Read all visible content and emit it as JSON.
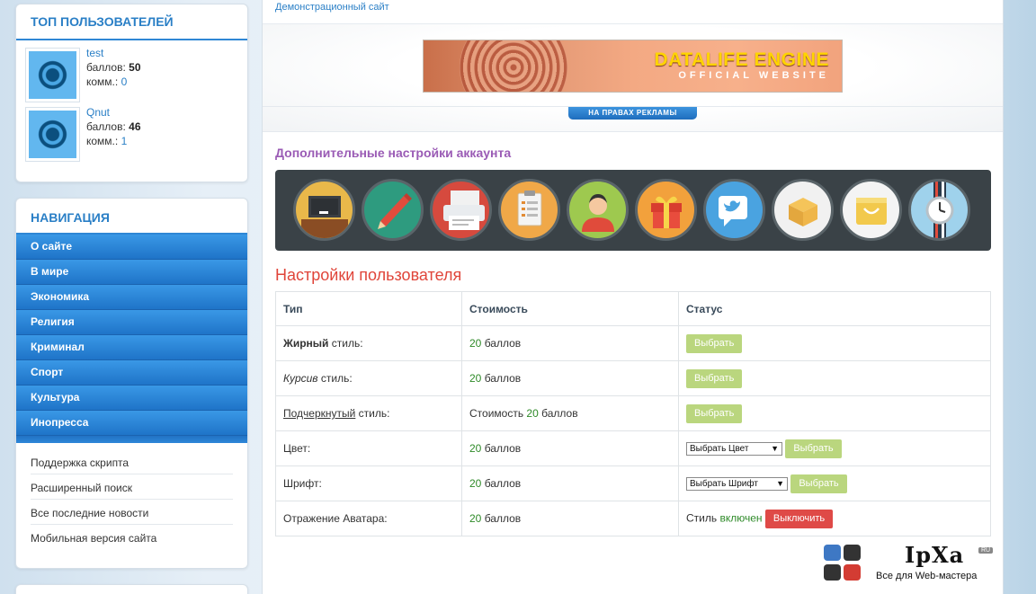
{
  "sidebar": {
    "top_users": {
      "title": "Топ пользователей",
      "users": [
        {
          "name": "test",
          "points_label": "баллов:",
          "points": "50",
          "comments_label": "комм.:",
          "comments": "0"
        },
        {
          "name": "Qnut",
          "points_label": "баллов:",
          "points": "46",
          "comments_label": "комм.:",
          "comments": "1"
        }
      ]
    },
    "navigation": {
      "title": "Навигация",
      "items": [
        "О сайте",
        "В мире",
        "Экономика",
        "Религия",
        "Криминал",
        "Спорт",
        "Культура",
        "Инопресса"
      ],
      "links": [
        "Поддержка скрипта",
        "Расширенный поиск",
        "Все последние новости",
        "Мобильная версия сайта"
      ]
    }
  },
  "main": {
    "site_link": "Демонстрационный сайт",
    "banner": {
      "line1": "DATALIFE ENGINE",
      "line2": "OFFICIAL WEBSITE",
      "badge": "НА ПРАВАХ РЕКЛАМЫ"
    },
    "section_title": "Дополнительные настройки аккаунта",
    "icons": [
      "blackboard-icon",
      "pencil-icon",
      "printer-icon",
      "clipboard-icon",
      "user-icon",
      "gift-icon",
      "twitter-icon",
      "box-icon",
      "shopping-bag-icon",
      "watch-icon"
    ],
    "settings_title": "Настройки пользователя",
    "table": {
      "headers": [
        "Тип",
        "Стоимость",
        "Статус"
      ],
      "rows": {
        "bold": {
          "type_strong": "Жирный",
          "type_rest": " стиль:",
          "cost_num": "20",
          "cost_unit": " баллов",
          "button": "Выбрать"
        },
        "italic": {
          "type_em": "Курсив",
          "type_rest": " стиль:",
          "cost_num": "20",
          "cost_unit": " баллов",
          "button": "Выбрать"
        },
        "underline": {
          "type_u": "Подчеркнутый",
          "type_rest": " стиль:",
          "cost_prefix": "Стоимость ",
          "cost_num": "20",
          "cost_unit": " баллов",
          "button": "Выбрать"
        },
        "color": {
          "type": "Цвет:",
          "cost_num": "20",
          "cost_unit": " баллов",
          "select": "Выбрать Цвет",
          "button": "Выбрать"
        },
        "font": {
          "type": "Шрифт:",
          "cost_num": "20",
          "cost_unit": " баллов",
          "select": "Выбрать Шрифт",
          "button": "Выбрать"
        },
        "avatar": {
          "type": "Отражение Аватара:",
          "cost_num": "20",
          "cost_unit": " баллов",
          "status_prefix": "Стиль ",
          "status_value": "включен",
          "button": "Выключить"
        }
      }
    }
  },
  "watermark": {
    "title": "IpXa",
    "ru": "RU",
    "subtitle": "Все для Web-мастера"
  },
  "colors": {
    "accent": "#2a7fc6",
    "nav_blue": "#2f8ee0",
    "section_purple": "#9a5bb5",
    "settings_red": "#e0453a",
    "btn_green": "#bad67e",
    "btn_red": "#df4a47",
    "icons_bg": "#3a4247"
  }
}
